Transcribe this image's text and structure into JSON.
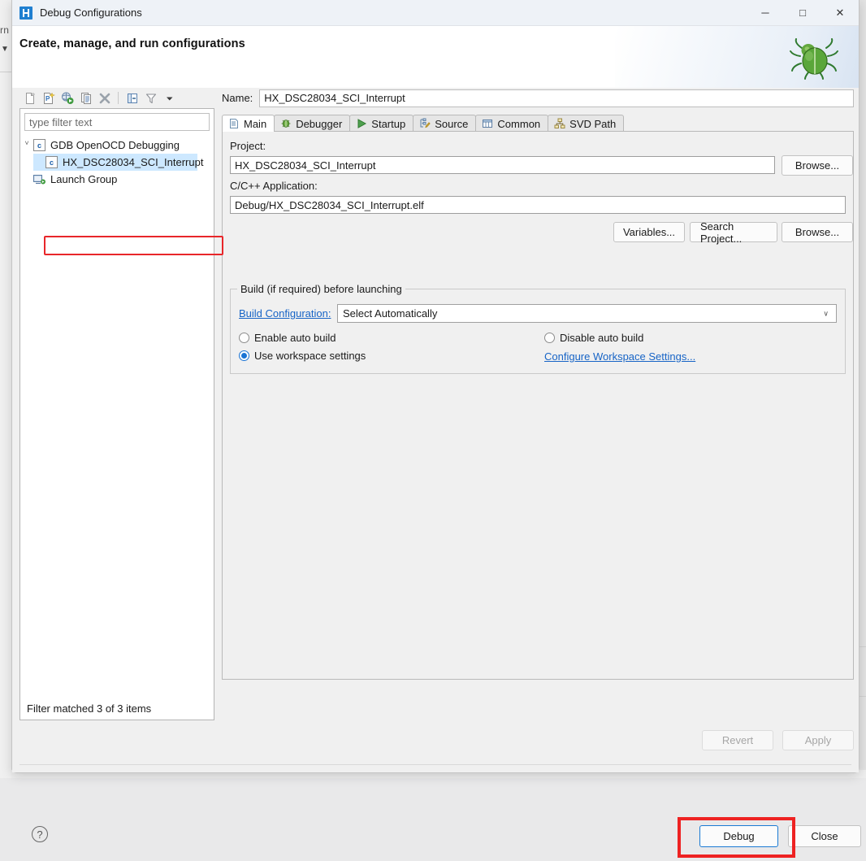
{
  "window": {
    "title": "Debug Configurations",
    "app_icon": "debug-configurations-icon",
    "minimize": "─",
    "maximize": "□",
    "close": "✕"
  },
  "header": {
    "title": "Create, manage, and run configurations",
    "decoration_icon": "green-bug-icon"
  },
  "background": {
    "text_fragment": "rn",
    "arrow_fragment": "▼"
  },
  "left_panel": {
    "toolbar": [
      {
        "name": "new-configuration-icon",
        "tooltip": "New launch configuration"
      },
      {
        "name": "new-prototype-icon",
        "tooltip": "New prototype"
      },
      {
        "name": "export-launch-icon",
        "tooltip": "Export"
      },
      {
        "name": "duplicate-icon",
        "tooltip": "Duplicate"
      },
      {
        "name": "delete-icon",
        "tooltip": "Delete"
      },
      {
        "name": "collapse-all-icon",
        "tooltip": "Collapse All"
      },
      {
        "name": "filter-icon",
        "tooltip": "Filter launch configurations"
      },
      {
        "name": "view-menu-icon",
        "tooltip": "View Menu"
      }
    ],
    "filter": {
      "value": "",
      "placeholder": "type filter text"
    },
    "tree": [
      {
        "label": "GDB OpenOCD Debugging",
        "icon": "c-config-icon",
        "expanded": true,
        "twisty": "ⱽ",
        "children": [
          {
            "label": "HX_DSC28034_SCI_Interrupt",
            "icon": "c-config-icon",
            "selected": true,
            "highlighted": true
          }
        ]
      },
      {
        "label": "Launch Group",
        "icon": "launch-group-icon",
        "expanded": false,
        "children": []
      }
    ],
    "status": "Filter matched 3 of 3 items"
  },
  "right_panel": {
    "name_label": "Name:",
    "name_value": "HX_DSC28034_SCI_Interrupt",
    "tabs": [
      {
        "label": "Main",
        "icon": "document-icon",
        "active": true
      },
      {
        "label": "Debugger",
        "icon": "debugger-bug-icon",
        "active": false
      },
      {
        "label": "Startup",
        "icon": "play-green-icon",
        "active": false
      },
      {
        "label": "Source",
        "icon": "source-pencil-icon",
        "active": false
      },
      {
        "label": "Common",
        "icon": "common-table-icon",
        "active": false
      },
      {
        "label": "SVD Path",
        "icon": "svd-tree-icon",
        "active": false
      }
    ],
    "main_tab": {
      "project_label": "Project:",
      "project_value": "HX_DSC28034_SCI_Interrupt",
      "project_browse": "Browse...",
      "application_label": "C/C++ Application:",
      "application_value": "Debug/HX_DSC28034_SCI_Interrupt.elf",
      "variables_button": "Variables...",
      "search_project_button": "Search Project...",
      "application_browse": "Browse...",
      "build_group": {
        "title": "Build (if required) before launching",
        "build_configuration_link": "Build Configuration:",
        "build_configuration_value": "Select Automatically",
        "build_configuration_arrow": "∨",
        "enable_auto_build": "Enable auto build",
        "disable_auto_build": "Disable auto build",
        "use_workspace_settings": "Use workspace settings",
        "configure_workspace_link": "Configure Workspace Settings...",
        "selected_option": "use_workspace_settings"
      }
    }
  },
  "footer": {
    "revert_button": "Revert",
    "revert_enabled": false,
    "apply_button": "Apply",
    "apply_enabled": false,
    "help_icon": "?",
    "debug_button": "Debug",
    "close_button": "Close"
  },
  "annotations": {
    "accent_red": "#ee2222",
    "focus_blue": "#1a7ad4",
    "selection_blue": "#cde8ff",
    "link_blue": "#1764c6"
  }
}
